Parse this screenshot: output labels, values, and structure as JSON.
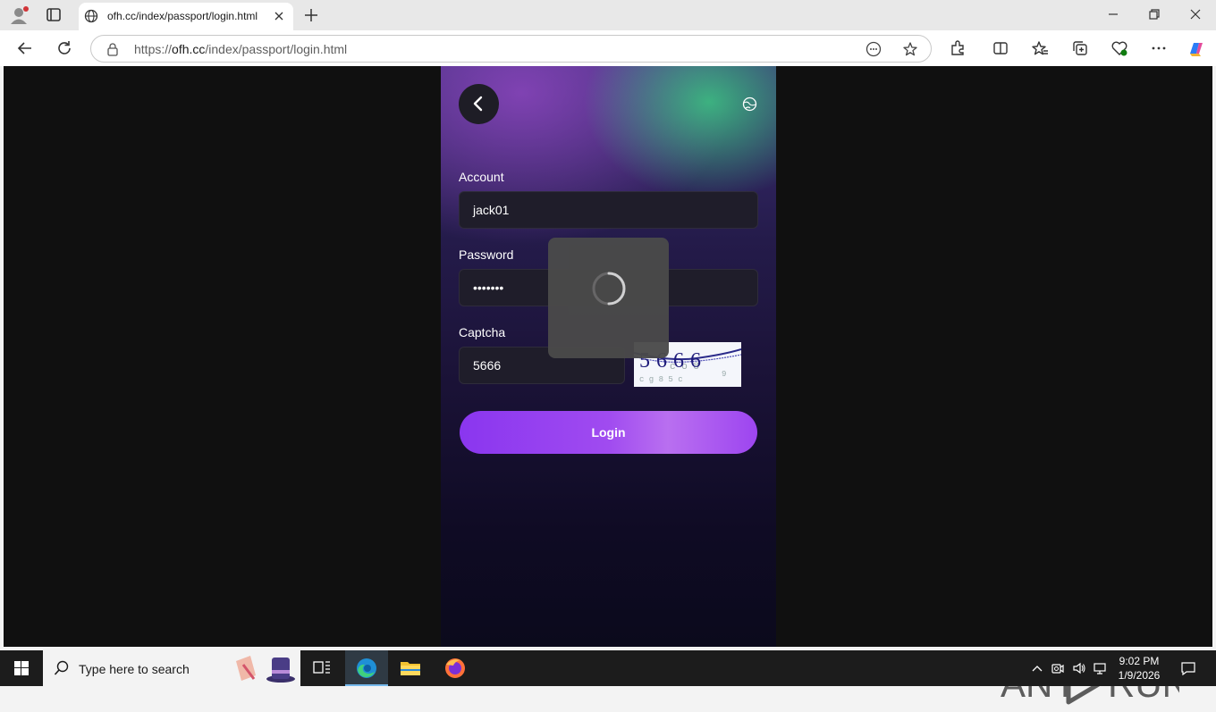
{
  "browser": {
    "tab_title": "ofh.cc/index/passport/login.html",
    "url_prefix": "https://",
    "url_host": "ofh.cc",
    "url_path": "/index/passport/login.html"
  },
  "login": {
    "account_label": "Account",
    "account_value": "jack01",
    "password_label": "Password",
    "password_value": "•••••••",
    "captcha_label": "Captcha",
    "captcha_value": "5666",
    "captcha_image_text": "5666",
    "login_label": "Login"
  },
  "watermark": {
    "text_left": "ANY",
    "text_right": "RUN"
  },
  "taskbar": {
    "search_placeholder": "Type here to search",
    "time": "9:02 PM",
    "date": "1/9/2026"
  },
  "colors": {
    "accent": "#8a36ef",
    "page_bg": "#101010",
    "field_bg": "#1f1d2a"
  }
}
